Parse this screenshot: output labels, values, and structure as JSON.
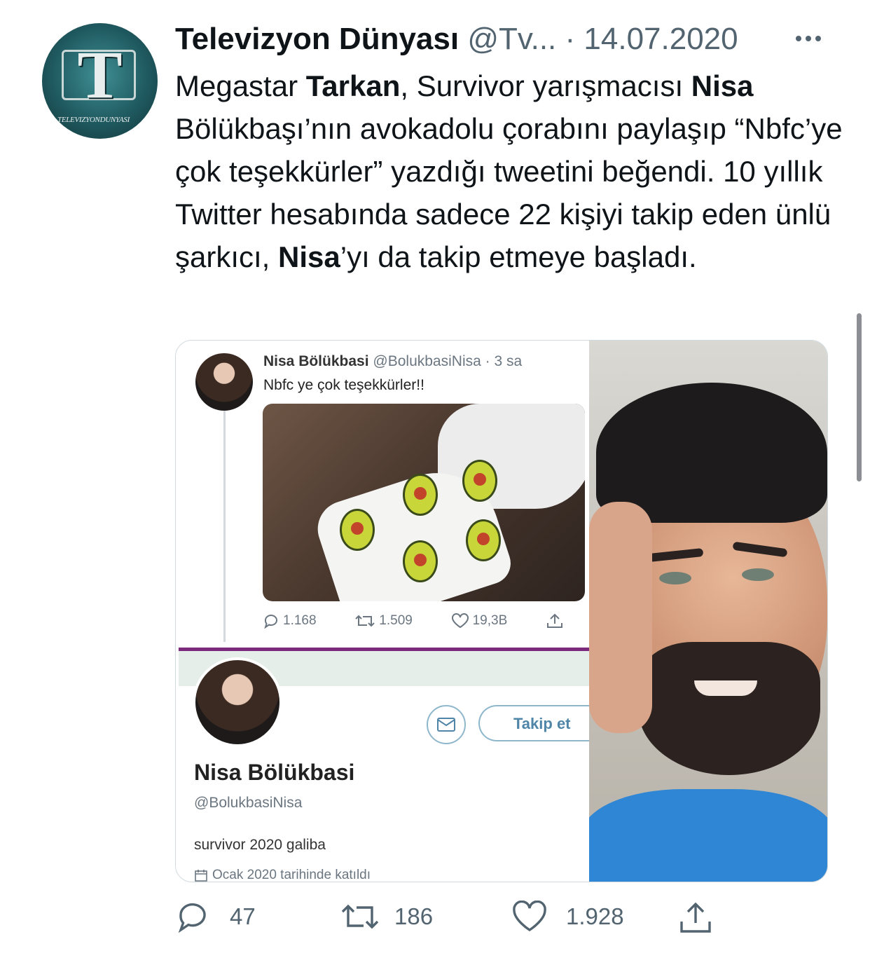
{
  "tweet": {
    "author_name": "Televizyon Dünyası",
    "handle": "@Tv...",
    "separator": "·",
    "date": "14.07.2020",
    "avatar_label": "TELEVIZYONDUNYASI",
    "text_parts": [
      "Megastar ",
      "Tarkan",
      ", Survivor yarışmacısı ",
      "Nisa",
      " Bölükbaşı’nın avokadolu çorabını paylaşıp “Nbfc’ye çok teşekkürler” yazdığı tweetini beğendi. 10 yıllık Twitter hesabında sadece 22 kişiyi takip eden ünlü şarkıcı, ",
      "Nisa",
      "’yı da takip etmeye başladı."
    ],
    "actions": {
      "replies": "47",
      "retweets": "186",
      "likes": "1.928"
    }
  },
  "embedded_tweet": {
    "author_name": "Nisa Bölükbasi",
    "handle": "@BolukbasiNisa",
    "time": "· 3 sa",
    "text": "Nbfc ye çok teşekkürler!!",
    "actions": {
      "replies": "1.168",
      "retweets": "1.509",
      "likes": "19,3B"
    }
  },
  "embedded_profile": {
    "follow_label": "Takip et",
    "name": "Nisa Bölükbasi",
    "handle": "@BolukbasiNisa",
    "bio": "survivor 2020 galiba",
    "joined": "Ocak 2020 tarihinde katıldı"
  },
  "colors": {
    "text": "#0f1419",
    "secondary": "#536471",
    "profile_divider": "#7b2a7d",
    "shirt": "#2f86d4"
  },
  "icons": [
    "more-icon",
    "reply-icon",
    "retweet-icon",
    "like-icon",
    "share-icon",
    "message-icon",
    "calendar-icon"
  ]
}
